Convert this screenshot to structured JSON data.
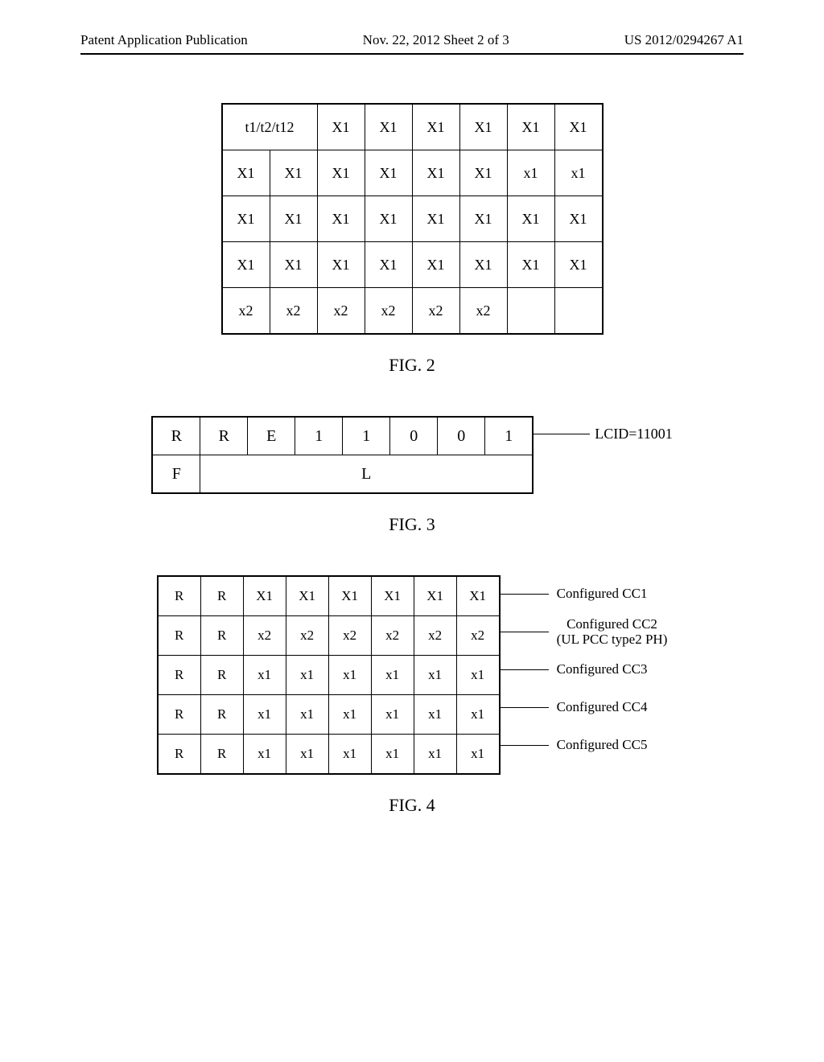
{
  "header": {
    "left": "Patent Application Publication",
    "center": "Nov. 22, 2012  Sheet 2 of 3",
    "right": "US 2012/0294267 A1"
  },
  "fig2": {
    "label": "FIG. 2",
    "row0_merged": "t1/t2/t12",
    "rows": [
      [
        "X1",
        "X1",
        "X1",
        "X1",
        "X1",
        "X1"
      ],
      [
        "X1",
        "X1",
        "X1",
        "X1",
        "X1",
        "X1",
        "x1",
        "x1"
      ],
      [
        "X1",
        "X1",
        "X1",
        "X1",
        "X1",
        "X1",
        "X1",
        "X1"
      ],
      [
        "X1",
        "X1",
        "X1",
        "X1",
        "X1",
        "X1",
        "X1",
        "X1"
      ],
      [
        "x2",
        "x2",
        "x2",
        "x2",
        "x2",
        "x2",
        "",
        ""
      ]
    ]
  },
  "fig3": {
    "label": "FIG. 3",
    "row0": [
      "R",
      "R",
      "E",
      "1",
      "1",
      "0",
      "0",
      "1"
    ],
    "row1_first": "F",
    "row1_merged": "L",
    "side_label": "LCID=11001"
  },
  "fig4": {
    "label": "FIG. 4",
    "rows": [
      {
        "cells": [
          "R",
          "R",
          "X1",
          "X1",
          "X1",
          "X1",
          "X1",
          "X1"
        ],
        "label": "Configured CC1"
      },
      {
        "cells": [
          "R",
          "R",
          "x2",
          "x2",
          "x2",
          "x2",
          "x2",
          "x2"
        ],
        "label": "Configured CC2\n(UL PCC type2 PH)"
      },
      {
        "cells": [
          "R",
          "R",
          "x1",
          "x1",
          "x1",
          "x1",
          "x1",
          "x1"
        ],
        "label": "Configured CC3"
      },
      {
        "cells": [
          "R",
          "R",
          "x1",
          "x1",
          "x1",
          "x1",
          "x1",
          "x1"
        ],
        "label": "Configured CC4"
      },
      {
        "cells": [
          "R",
          "R",
          "x1",
          "x1",
          "x1",
          "x1",
          "x1",
          "x1"
        ],
        "label": "Configured CC5"
      }
    ]
  },
  "chart_data": [
    {
      "type": "table",
      "title": "FIG. 2",
      "rows": [
        [
          "t1/t2/t12",
          "t1/t2/t12",
          "X1",
          "X1",
          "X1",
          "X1",
          "X1",
          "X1"
        ],
        [
          "X1",
          "X1",
          "X1",
          "X1",
          "X1",
          "X1",
          "x1",
          "x1"
        ],
        [
          "X1",
          "X1",
          "X1",
          "X1",
          "X1",
          "X1",
          "X1",
          "X1"
        ],
        [
          "X1",
          "X1",
          "X1",
          "X1",
          "X1",
          "X1",
          "X1",
          "X1"
        ],
        [
          "x2",
          "x2",
          "x2",
          "x2",
          "x2",
          "x2",
          "",
          ""
        ]
      ]
    },
    {
      "type": "table",
      "title": "FIG. 3",
      "rows": [
        [
          "R",
          "R",
          "E",
          "1",
          "1",
          "0",
          "0",
          "1"
        ],
        [
          "F",
          "L",
          "L",
          "L",
          "L",
          "L",
          "L",
          "L"
        ]
      ],
      "annotations": [
        "LCID=11001"
      ]
    },
    {
      "type": "table",
      "title": "FIG. 4",
      "rows": [
        [
          "R",
          "R",
          "X1",
          "X1",
          "X1",
          "X1",
          "X1",
          "X1"
        ],
        [
          "R",
          "R",
          "x2",
          "x2",
          "x2",
          "x2",
          "x2",
          "x2"
        ],
        [
          "R",
          "R",
          "x1",
          "x1",
          "x1",
          "x1",
          "x1",
          "x1"
        ],
        [
          "R",
          "R",
          "x1",
          "x1",
          "x1",
          "x1",
          "x1",
          "x1"
        ],
        [
          "R",
          "R",
          "x1",
          "x1",
          "x1",
          "x1",
          "x1",
          "x1"
        ]
      ],
      "annotations": [
        "Configured CC1",
        "Configured CC2 (UL PCC type2 PH)",
        "Configured CC3",
        "Configured CC4",
        "Configured CC5"
      ]
    }
  ]
}
